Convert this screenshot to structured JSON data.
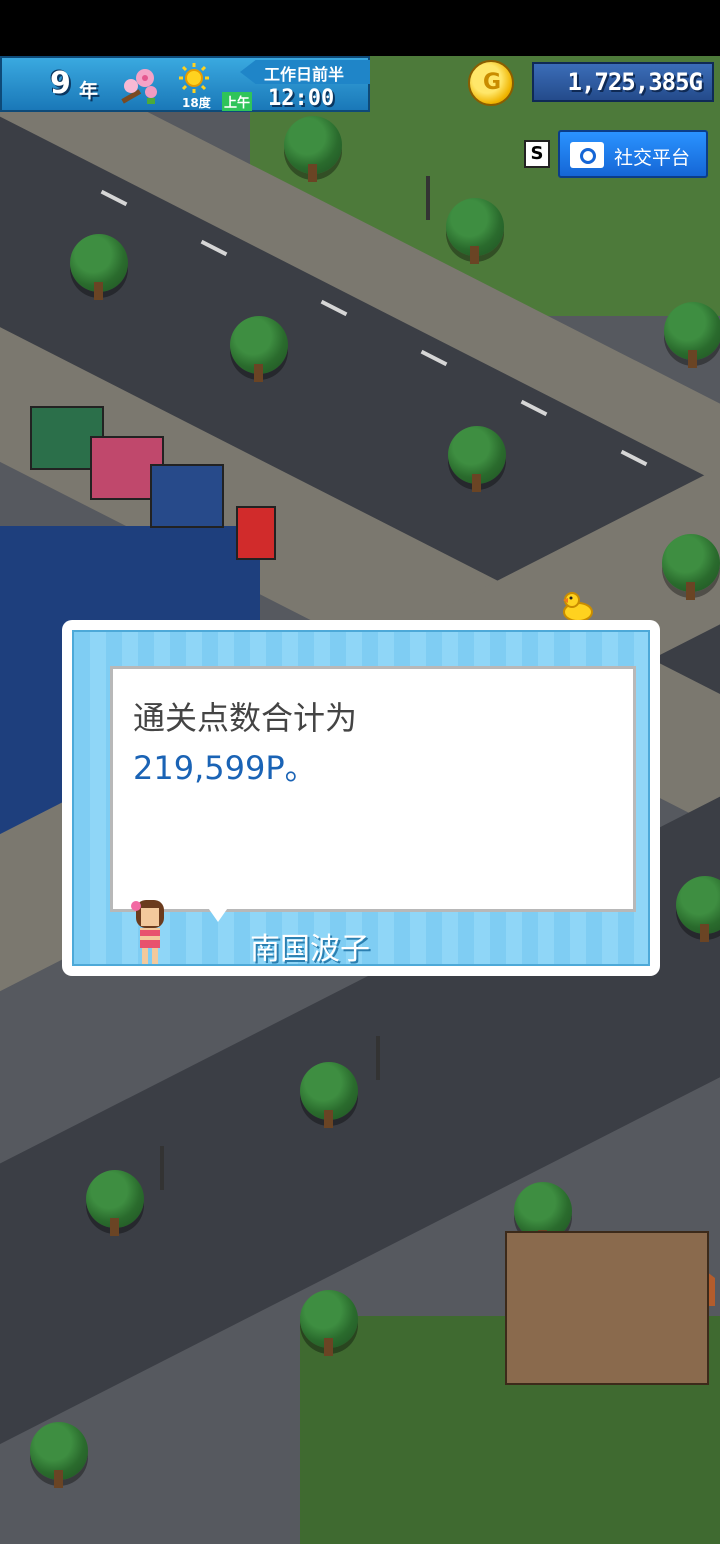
{
  "hud": {
    "year_number": "9",
    "year_unit": "年",
    "temperature": "18度",
    "period": "工作日前半",
    "am_pm": "上午",
    "time": "12:00",
    "money": "1,725,385",
    "currency": "G",
    "coin_symbol": "G"
  },
  "social": {
    "key": "S",
    "label": "社交平台"
  },
  "dialog": {
    "line1": "通关点数合计为",
    "line2": "219,599P。",
    "speaker": "南国波子"
  },
  "colors": {
    "hud_blue": "#1f85c8",
    "money_blue": "#244b8b",
    "social_blue": "#1566d6",
    "dialog_tile": "#7fcdf3",
    "points_text": "#1a63b5"
  }
}
